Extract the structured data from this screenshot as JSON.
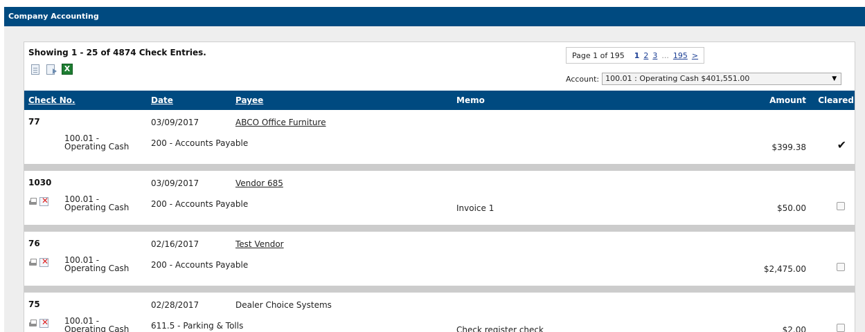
{
  "window": {
    "title": "Company Accounting"
  },
  "summary": {
    "text": "Showing 1 - 25 of 4874 Check Entries."
  },
  "toolbar": {
    "icons": [
      "report-icon",
      "export-report-icon",
      "excel-icon"
    ],
    "excel_glyph": "X"
  },
  "pager": {
    "info": "Page 1 of 195",
    "current": "1",
    "pages": [
      "2",
      "3"
    ],
    "ellipsis": "...",
    "last": "195",
    "next": ">"
  },
  "account": {
    "label": "Account:",
    "selected": "100.01 : Operating Cash $401,551.00"
  },
  "columns": {
    "check_no": "Check No.",
    "date": "Date",
    "payee": "Payee",
    "memo": "Memo",
    "amount": "Amount",
    "cleared": "Cleared"
  },
  "entries": [
    {
      "check_no": "77",
      "date": "03/09/2017",
      "payee": "ABCO Office Furniture",
      "account_line1": "100.01 -",
      "account_line2": "Operating Cash",
      "gl": "200 - Accounts Payable",
      "memo": "",
      "amount": "$399.38",
      "cleared": true
    },
    {
      "check_no": "1030",
      "date": "03/09/2017",
      "payee": "Vendor 685",
      "account_line1": "100.01 -",
      "account_line2": "Operating Cash",
      "gl": "200 - Accounts Payable",
      "memo": "Invoice 1",
      "amount": "$50.00",
      "cleared": false
    },
    {
      "check_no": "76",
      "date": "02/16/2017",
      "payee": "Test Vendor",
      "account_line1": "100.01 -",
      "account_line2": "Operating Cash",
      "gl": "200 - Accounts Payable",
      "memo": "",
      "amount": "$2,475.00",
      "cleared": false
    },
    {
      "check_no": "75",
      "date": "02/28/2017",
      "payee": "Dealer Choice Systems",
      "account_line1": "100.01 -",
      "account_line2": "Operating Cash",
      "gl": "611.5 - Parking & Tolls",
      "memo": "Check register check",
      "amount": "$2.00",
      "cleared": false
    }
  ],
  "glyphs": {
    "check": "✔",
    "void": "✕",
    "caret": "▼"
  }
}
